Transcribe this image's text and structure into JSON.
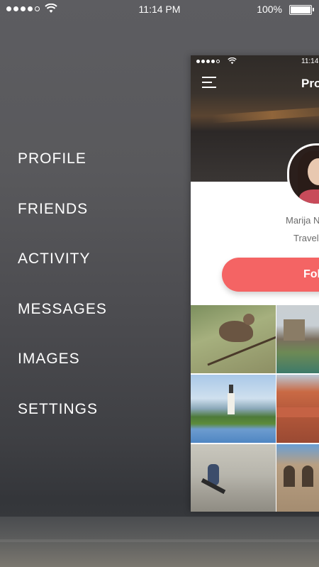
{
  "status_bar": {
    "time": "11:14 PM",
    "battery": "100%",
    "signal_icon": "signal-dots-icon",
    "wifi_icon": "wifi-icon",
    "battery_icon": "battery-icon"
  },
  "menu": {
    "items": [
      {
        "label": "PROFILE"
      },
      {
        "label": "FRIENDS"
      },
      {
        "label": "ACTIVITY"
      },
      {
        "label": "MESSAGES"
      },
      {
        "label": "IMAGES"
      },
      {
        "label": "SETTINGS"
      }
    ]
  },
  "preview": {
    "status_time": "11:14",
    "title": "Profile",
    "user_name": "Marija N",
    "user_role": "Travel",
    "follow_label": "Follow",
    "accent_color": "#f46464",
    "menu_icon": "hamburger-icon"
  }
}
